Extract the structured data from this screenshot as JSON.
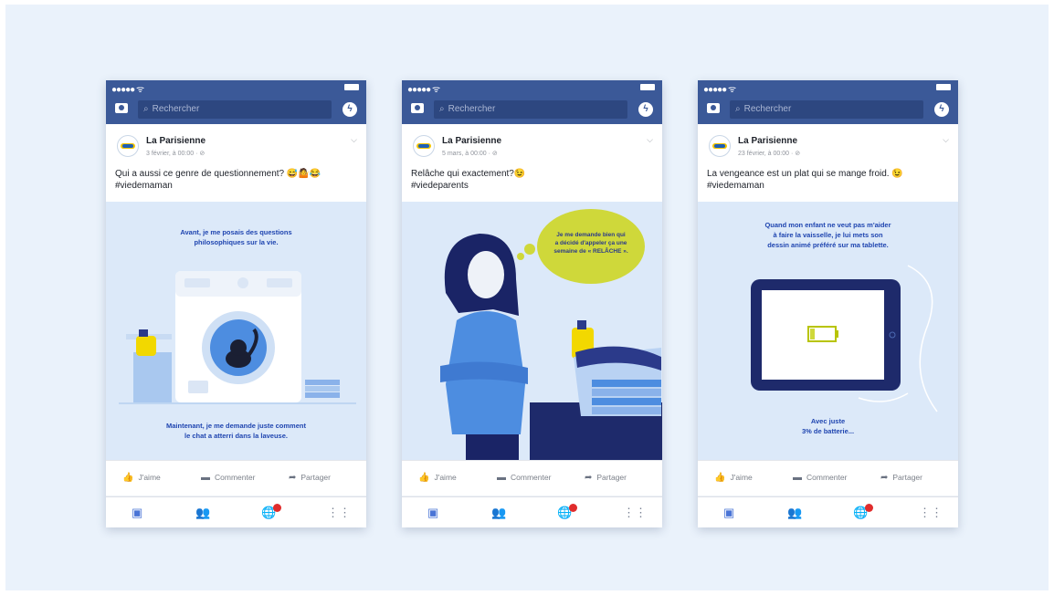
{
  "phones": [
    {
      "search_placeholder": "Rechercher",
      "page_name": "La Parisienne",
      "date": "3 février, à 00:00 · ⊘",
      "post_line1": "Qui a aussi ce genre de questionnement? 😅🤷😂",
      "post_line2": "#viedemaman",
      "cap_top_1": "Avant, je me posais des questions",
      "cap_top_2": "philosophiques sur la vie.",
      "cap_bottom_1": "Maintenant, je me demande juste comment",
      "cap_bottom_2": "le chat a atterri dans la laveuse.",
      "like": "J'aime",
      "comment": "Commenter",
      "share": "Partager"
    },
    {
      "search_placeholder": "Rechercher",
      "page_name": "La Parisienne",
      "date": "5 mars, à 00:00 · ⊘",
      "post_line1": "Relâche qui exactement?😉",
      "post_line2": "#viedeparents",
      "bubble_1": "Je me demande bien qui",
      "bubble_2": "a décidé d'appeler ça une",
      "bubble_3": "semaine de « RELÂCHE ».",
      "like": "J'aime",
      "comment": "Commenter",
      "share": "Partager"
    },
    {
      "search_placeholder": "Rechercher",
      "page_name": "La Parisienne",
      "date": "23 février, à 00:00 · ⊘",
      "post_line1": "La vengeance est un plat qui se mange froid. 😉",
      "post_line2": "#viedemaman",
      "cap_top_1": "Quand mon enfant ne veut pas m'aider",
      "cap_top_2": "à faire la vaisselle, je lui mets son",
      "cap_top_3": "dessin animé préféré sur ma tablette.",
      "cap_bottom_1": "Avec juste",
      "cap_bottom_2": "3% de batterie...",
      "like": "J'aime",
      "comment": "Commenter",
      "share": "Partager"
    }
  ],
  "colors": {
    "facebook_blue": "#3b5998",
    "caption_blue": "#1f45b0",
    "illustration_bg": "#dce9f9",
    "bubble_yellow": "#cfd83a",
    "notification_red": "#e02c2c"
  },
  "icons": [
    "camera-icon",
    "search-icon",
    "messenger-icon",
    "like-icon",
    "comment-icon",
    "share-icon",
    "news-feed-icon",
    "friends-icon",
    "notifications-icon",
    "menu-grid-icon"
  ]
}
